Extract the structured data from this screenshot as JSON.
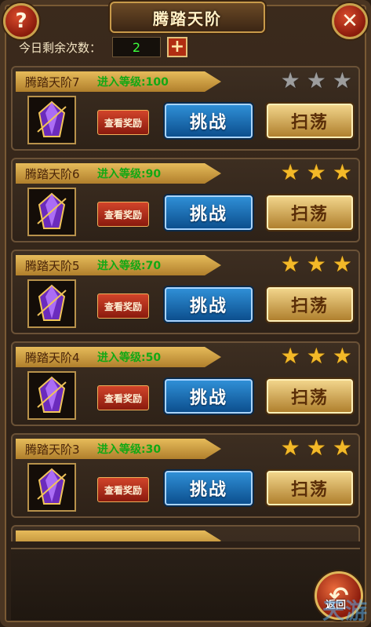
{
  "header": {
    "title": "腾踏天阶",
    "help_icon": "?",
    "close_icon": "✕"
  },
  "remaining": {
    "label": "今日剩余次数：",
    "value": "2",
    "plus_icon": "+"
  },
  "stages": [
    {
      "name": "腾踏天阶7",
      "requirement": "进入等级:100",
      "stars": 0,
      "reward_label": "查看奖励",
      "challenge_label": "挑战",
      "sweep_label": "扫荡"
    },
    {
      "name": "腾踏天阶6",
      "requirement": "进入等级:90",
      "stars": 3,
      "reward_label": "查看奖励",
      "challenge_label": "挑战",
      "sweep_label": "扫荡"
    },
    {
      "name": "腾踏天阶5",
      "requirement": "进入等级:70",
      "stars": 3,
      "reward_label": "查看奖励",
      "challenge_label": "挑战",
      "sweep_label": "扫荡"
    },
    {
      "name": "腾踏天阶4",
      "requirement": "进入等级:50",
      "stars": 3,
      "reward_label": "查看奖励",
      "challenge_label": "挑战",
      "sweep_label": "扫荡"
    },
    {
      "name": "腾踏天阶3",
      "requirement": "进入等级:30",
      "stars": 3,
      "reward_label": "查看奖励",
      "challenge_label": "挑战",
      "sweep_label": "扫荡"
    }
  ],
  "footer": {
    "back_label": "返回",
    "back_icon": "↶"
  },
  "watermark": "天游",
  "colors": {
    "requirement_green": "#13a814",
    "star_gold": "#f3b928",
    "star_grey": "#9d9d9d",
    "challenge_blue": "#1e6fb3",
    "sweep_gold": "#d7a64d"
  }
}
